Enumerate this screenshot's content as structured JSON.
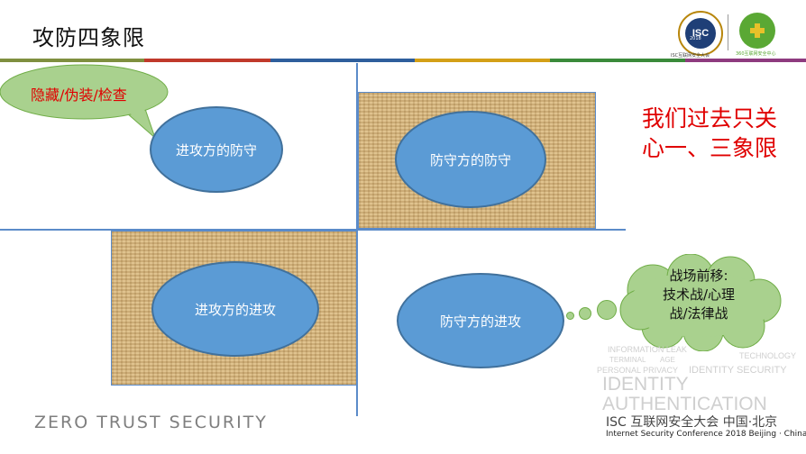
{
  "slide": {
    "title": "攻防四象限",
    "callout": "隐藏/伪装/检查",
    "quadrants": {
      "top_left": "进攻方的防守",
      "top_right": "防守方的防守",
      "bottom_left": "进攻方的进攻",
      "bottom_right": "防守方的进攻"
    },
    "thought": {
      "line1": "战场前移:",
      "line2": "技术战/心理",
      "line3": "战/法律战"
    },
    "note": "我们过去只关心一、三象限",
    "watermark": "ZERO TRUST SECURITY"
  },
  "branding": {
    "isc_logo": "ISC",
    "isc_year": "2018",
    "isc_logo_caption": "ISC互联网安全大会",
    "org_logo_caption": "360互联网安全中心",
    "footer_title": "ISC 互联网安全大会 中国·北京",
    "footer_subtitle": "Internet Security Conference 2018  Beijing · China"
  },
  "keyword_cloud": [
    "INFORMATION LEAK",
    "TERMINAL",
    "AGE",
    "TECHNOLOGY",
    "PERSONAL PRIVACY",
    "IDENTITY SECURITY",
    "IDENTITY",
    "AUTHENTICATION"
  ],
  "colors": {
    "ellipse_fill": "#5b9bd5",
    "ellipse_border": "#41719c",
    "bubble_fill": "#a9d18e",
    "callout_text": "#e00000",
    "note_text": "#e00000",
    "axis_line": "#5b8bc9"
  }
}
